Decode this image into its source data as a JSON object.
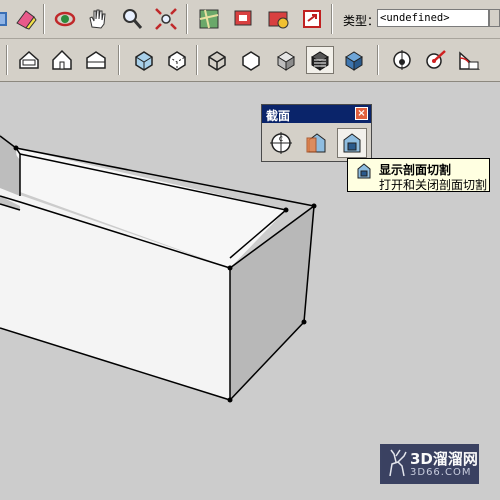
{
  "toolbar_top": {
    "type_label": "类型：",
    "type_value": "<undefined>"
  },
  "section_palette": {
    "title": "截面",
    "close_glyph": "×",
    "buttons": [
      {
        "icon": "section-plane-icon"
      },
      {
        "icon": "display-section-planes-icon"
      },
      {
        "icon": "display-section-cuts-icon",
        "active": true
      }
    ]
  },
  "tooltip": {
    "title": "显示剖面切割",
    "description": "打开和关闭剖面切割"
  },
  "watermark": {
    "text": "3D溜溜网",
    "subtext": "3D66.COM"
  },
  "colors": {
    "toolbar_bg": "#d4d0c8",
    "viewport_bg": "#cccccc",
    "titlebar": "#0a246a",
    "tooltip_bg": "#ffffe1"
  }
}
